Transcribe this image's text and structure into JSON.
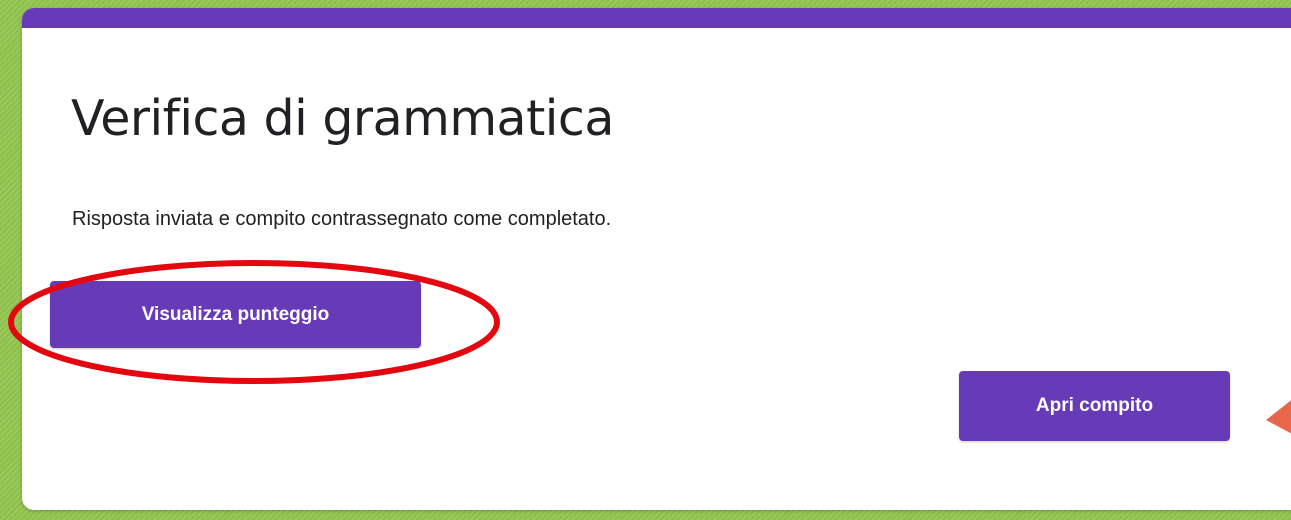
{
  "form": {
    "title": "Verifica di grammatica",
    "confirmation": "Risposta inviata e compito contrassegnato come completato."
  },
  "buttons": {
    "view_score": "Visualizza punteggio",
    "open_assignment": "Apri compito"
  },
  "annotations": {
    "highlight_color": "#e3070f",
    "arrow_color": "#e8674a"
  },
  "colors": {
    "accent": "#673ab7",
    "background": "#8fc14a",
    "text": "#202124"
  }
}
